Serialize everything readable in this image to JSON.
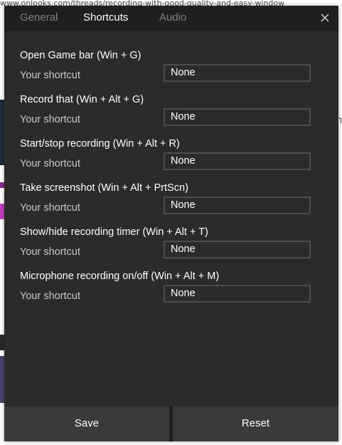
{
  "background": {
    "url_text": "www.onlooks.com/threads/recording-with-good-quality-and-easy-window",
    "right_text": "n"
  },
  "tabs": [
    {
      "label": "General"
    },
    {
      "label": "Shortcuts"
    },
    {
      "label": "Audio"
    }
  ],
  "active_tab": "Shortcuts",
  "shortcut_label": "Your shortcut",
  "shortcuts": [
    {
      "action": "Open Game bar (Win + G)",
      "value": "None"
    },
    {
      "action": "Record that (Win + Alt + G)",
      "value": "None"
    },
    {
      "action": "Start/stop recording (Win + Alt + R)",
      "value": "None"
    },
    {
      "action": "Take screenshot (Win + Alt + PrtScn)",
      "value": "None"
    },
    {
      "action": "Show/hide recording timer (Win + Alt + T)",
      "value": "None"
    },
    {
      "action": "Microphone recording on/off (Win + Alt + M)",
      "value": "None"
    }
  ],
  "footer": {
    "save_label": "Save",
    "reset_label": "Reset"
  },
  "colors": {
    "dialog_bg": "#2b2b2b",
    "tabbar_bg": "#1f1f1f",
    "button_bg": "#3a3a3a",
    "inactive_tab": "#7f7f7f"
  },
  "icons": {
    "close": "close-icon"
  }
}
